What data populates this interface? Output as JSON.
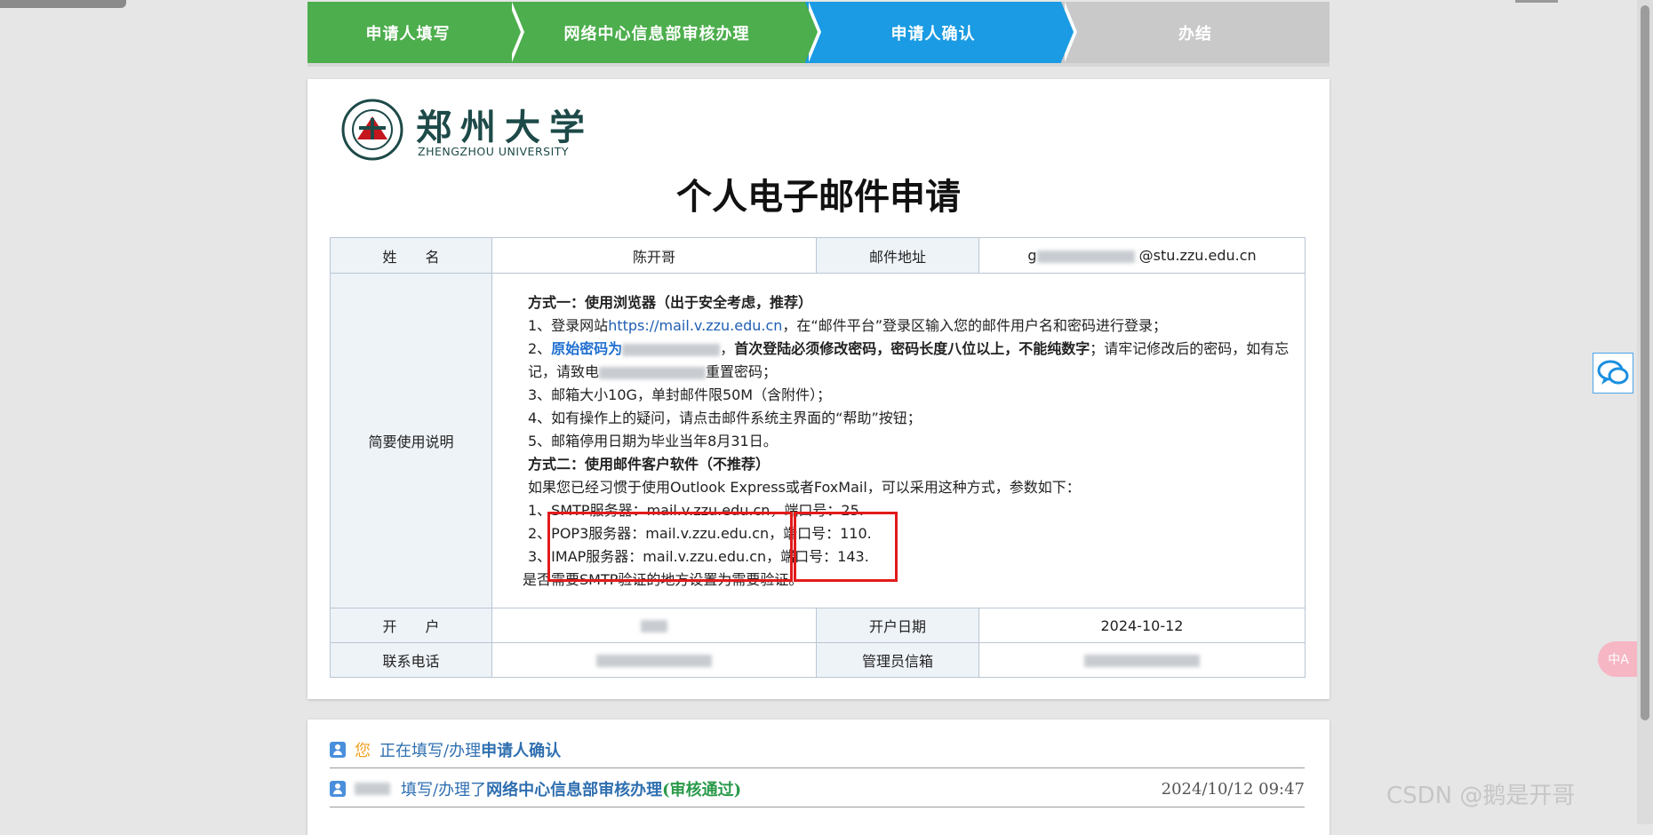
{
  "steps": [
    {
      "label": "申请人填写",
      "state": "done"
    },
    {
      "label": "网络中心信息部审核办理",
      "state": "done"
    },
    {
      "label": "申请人确认",
      "state": "active"
    },
    {
      "label": "办结",
      "state": "todo"
    }
  ],
  "colors": {
    "done": "#4cae4c",
    "active": "#1a9be3",
    "todo": "#c9c9c9",
    "highlight_box": "#e21b1b",
    "link": "#1f5fb4"
  },
  "logo": {
    "cn": "郑州大学",
    "en": "ZHENGZHOU UNIVERSITY",
    "seal_icon": "university-seal-icon"
  },
  "doc_title": "个人电子邮件申请",
  "form": {
    "name_label": "姓　　名",
    "name_value": "陈开哥",
    "email_label": "邮件地址",
    "email_prefix": "g",
    "email_domain": "@stu.zzu.edu.cn",
    "instructions_label": "简要使用说明",
    "open_label": "开　　户",
    "open_date_label": "开户日期",
    "open_date_value": "2024-10-12",
    "phone_label": "联系电话",
    "admin_email_label": "管理员信箱"
  },
  "instructions": {
    "m1_title": "方式一：使用浏览器（出于安全考虑，推荐）",
    "m1_1a": "1、登录网站",
    "m1_1_link": "https://mail.v.zzu.edu.cn",
    "m1_1b": "，在“邮件平台”登录区输入您的邮件用户名和密码进行登录；",
    "m1_2a": "2、",
    "m1_2_hl": "原始密码为",
    "m1_2b": "，",
    "m1_2_bold": "首次登陆必须修改密码，密码长度八位以上，不能纯数字",
    "m1_2c": "；请牢记修改后的密码，如有忘记，请致电",
    "m1_2d": "重置密码；",
    "m1_3": "3、邮箱大小10G，单封邮件限50M（含附件）；",
    "m1_4": "4、如有操作上的疑问，请点击邮件系统主界面的“帮助”按钮；",
    "m1_5": "5、邮箱停用日期为毕业当年8月31日。",
    "m2_title": "方式二：使用邮件客户软件（不推荐）",
    "m2_intro": "如果您已经习惯于使用Outlook Express或者FoxMail，可以采用这种方式，参数如下：",
    "m2_1": "1、SMTP服务器：mail.v.zzu.edu.cn，端口号：25.",
    "m2_2": "2、POP3服务器：mail.v.zzu.edu.cn，端口号：110.",
    "m2_3": "3、IMAP服务器：mail.v.zzu.edu.cn，端口号：143.",
    "m2_end": "是否需要SMTP验证的地方设置为需要验证。"
  },
  "log": {
    "row1_you": "您",
    "row1_text": "正在填写/办理",
    "row1_step": "申请人确认",
    "row2_text": "填写/办理了",
    "row2_step": "网络中心信息部审核办理",
    "row2_status": "(审核通过)",
    "row2_time": "2024/10/12 09:47"
  },
  "side": {
    "chat_icon": "chat-bubbles-icon",
    "translate_label": "中A"
  },
  "watermark": "CSDN @鹅是开哥"
}
